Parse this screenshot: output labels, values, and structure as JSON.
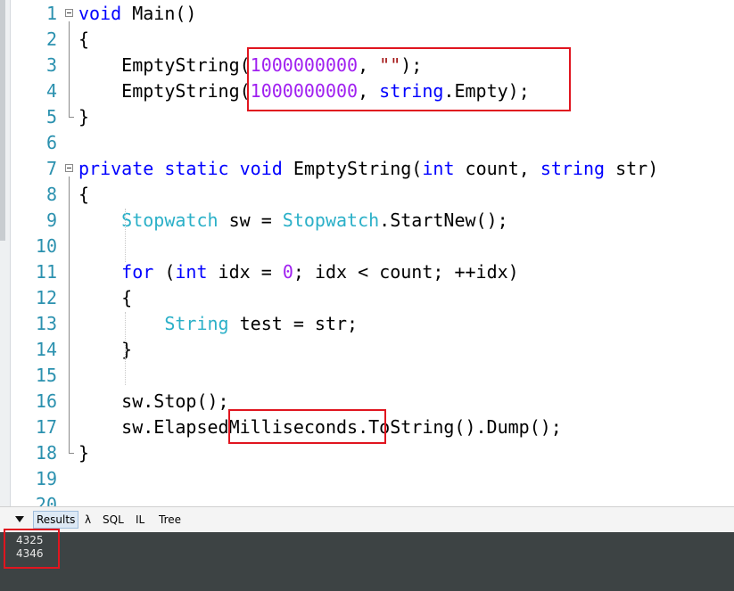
{
  "editor": {
    "lines": [
      {
        "n": "1",
        "parts": [
          {
            "t": "void",
            "c": "kw"
          },
          {
            "t": " Main()",
            "c": ""
          }
        ]
      },
      {
        "n": "2",
        "parts": [
          {
            "t": "{",
            "c": ""
          }
        ]
      },
      {
        "n": "3",
        "parts": [
          {
            "t": "    EmptyString(",
            "c": ""
          },
          {
            "t": "1000000000",
            "c": "num"
          },
          {
            "t": ", ",
            "c": ""
          },
          {
            "t": "\"\"",
            "c": "str"
          },
          {
            "t": ");",
            "c": ""
          }
        ]
      },
      {
        "n": "4",
        "parts": [
          {
            "t": "    EmptyString(",
            "c": ""
          },
          {
            "t": "1000000000",
            "c": "num"
          },
          {
            "t": ", ",
            "c": ""
          },
          {
            "t": "string",
            "c": "kw"
          },
          {
            "t": ".Empty);",
            "c": ""
          }
        ]
      },
      {
        "n": "5",
        "parts": [
          {
            "t": "}",
            "c": ""
          }
        ]
      },
      {
        "n": "6",
        "parts": []
      },
      {
        "n": "7",
        "parts": [
          {
            "t": "private",
            "c": "kw"
          },
          {
            "t": " ",
            "c": ""
          },
          {
            "t": "static",
            "c": "kw"
          },
          {
            "t": " ",
            "c": ""
          },
          {
            "t": "void",
            "c": "kw"
          },
          {
            "t": " EmptyString(",
            "c": ""
          },
          {
            "t": "int",
            "c": "kw"
          },
          {
            "t": " count, ",
            "c": ""
          },
          {
            "t": "string",
            "c": "kw"
          },
          {
            "t": " str)",
            "c": ""
          }
        ]
      },
      {
        "n": "8",
        "parts": [
          {
            "t": "{",
            "c": ""
          }
        ]
      },
      {
        "n": "9",
        "parts": [
          {
            "t": "    ",
            "c": ""
          },
          {
            "t": "Stopwatch",
            "c": "typ"
          },
          {
            "t": " sw = ",
            "c": ""
          },
          {
            "t": "Stopwatch",
            "c": "typ"
          },
          {
            "t": ".StartNew();",
            "c": ""
          }
        ]
      },
      {
        "n": "10",
        "parts": []
      },
      {
        "n": "11",
        "parts": [
          {
            "t": "    ",
            "c": ""
          },
          {
            "t": "for",
            "c": "kw"
          },
          {
            "t": " (",
            "c": ""
          },
          {
            "t": "int",
            "c": "kw"
          },
          {
            "t": " idx = ",
            "c": ""
          },
          {
            "t": "0",
            "c": "num"
          },
          {
            "t": "; idx < count; ++idx)",
            "c": ""
          }
        ]
      },
      {
        "n": "12",
        "parts": [
          {
            "t": "    {",
            "c": ""
          }
        ]
      },
      {
        "n": "13",
        "parts": [
          {
            "t": "        ",
            "c": ""
          },
          {
            "t": "String",
            "c": "typ"
          },
          {
            "t": " test = str;",
            "c": ""
          }
        ]
      },
      {
        "n": "14",
        "parts": [
          {
            "t": "    }",
            "c": ""
          }
        ]
      },
      {
        "n": "15",
        "parts": []
      },
      {
        "n": "16",
        "parts": [
          {
            "t": "    sw.Stop();",
            "c": ""
          }
        ]
      },
      {
        "n": "17",
        "parts": [
          {
            "t": "    sw.ElapsedMilliseconds.ToString().Dump();",
            "c": ""
          }
        ]
      },
      {
        "n": "18",
        "parts": [
          {
            "t": "}",
            "c": ""
          }
        ]
      },
      {
        "n": "19",
        "parts": []
      },
      {
        "n": "20",
        "parts": []
      }
    ]
  },
  "tabs": {
    "results": "Results",
    "lambda": "λ",
    "sql": "SQL",
    "il": "IL",
    "tree": "Tree"
  },
  "results": [
    "4325",
    "4346"
  ]
}
